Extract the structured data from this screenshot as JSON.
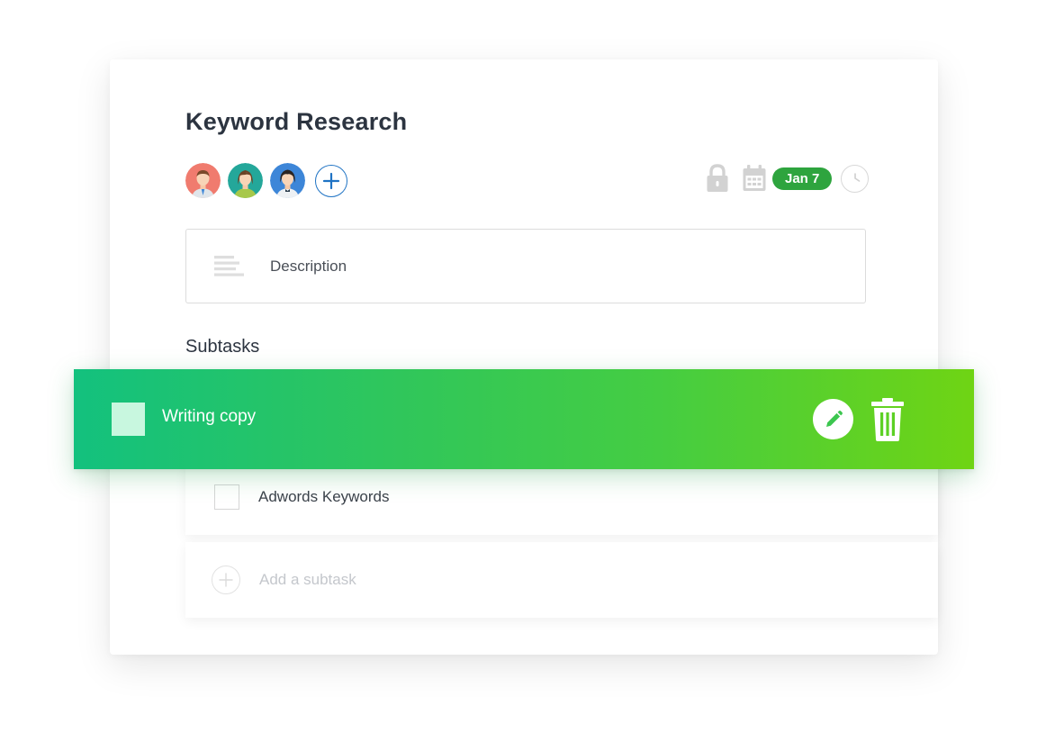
{
  "task": {
    "title": "Keyword Research",
    "due_date": "Jan 7"
  },
  "members": [
    {
      "icon": "avatar-man-tie",
      "bg": "#f07b6e"
    },
    {
      "icon": "avatar-woman-brown-hair",
      "bg": "#24a79a"
    },
    {
      "icon": "avatar-woman-dark-hair",
      "bg": "#3d86d8"
    }
  ],
  "description": {
    "placeholder": "Description"
  },
  "subtasks": {
    "heading": "Subtasks",
    "items": [
      {
        "label": "Writing copy",
        "state": "active-swipe"
      },
      {
        "label": "Adwords Keywords",
        "state": "normal"
      }
    ],
    "add_label": "Add a subtask"
  },
  "colors": {
    "accent_blue": "#1f73c4",
    "date_badge_green": "#2ea43e",
    "swipe_gradient_start": "#13c17e",
    "swipe_gradient_end": "#6fd414"
  },
  "icons": [
    "plus-icon",
    "lock-icon",
    "calendar-icon",
    "clock-icon",
    "lines-icon",
    "pencil-icon",
    "trash-icon"
  ]
}
